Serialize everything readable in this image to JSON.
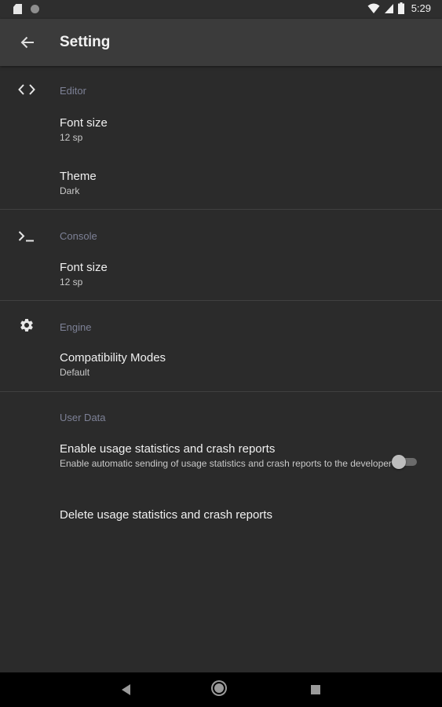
{
  "status_bar": {
    "time": "5:29",
    "icons": [
      "sd-card-icon",
      "circle-icon",
      "wifi-icon",
      "signal-icon",
      "battery-icon"
    ]
  },
  "app_bar": {
    "title": "Setting",
    "back_icon": "arrow-back-icon"
  },
  "sections": {
    "editor": {
      "title": "Editor",
      "icon": "code-icon",
      "items": [
        {
          "title": "Font size",
          "summary": "12 sp"
        },
        {
          "title": "Theme",
          "summary": "Dark"
        }
      ]
    },
    "console": {
      "title": "Console",
      "icon": "terminal-icon",
      "items": [
        {
          "title": "Font size",
          "summary": "12 sp"
        }
      ]
    },
    "engine": {
      "title": "Engine",
      "icon": "gear-icon",
      "items": [
        {
          "title": "Compatibility Modes",
          "summary": "Default"
        }
      ]
    },
    "user_data": {
      "title": "User Data",
      "items": [
        {
          "title": "Enable usage statistics and crash reports",
          "summary": "Enable automatic sending of usage statistics and crash reports to the developer",
          "toggle_on": false
        },
        {
          "title": "Delete usage statistics and crash reports"
        }
      ]
    }
  },
  "colors": {
    "background": "#2b2b2b",
    "app_bar": "#3b3b3b",
    "section_title": "#7d8196",
    "divider": "#404040"
  },
  "nav_bar": {
    "icons": [
      "nav-back-icon",
      "nav-home-icon",
      "nav-recents-icon"
    ]
  }
}
